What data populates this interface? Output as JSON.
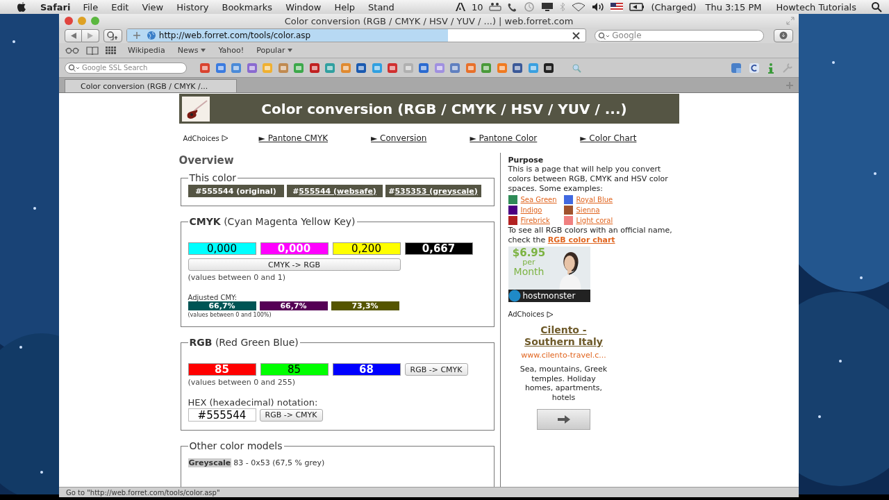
{
  "menu_bar": {
    "app": "Safari",
    "items": [
      "File",
      "Edit",
      "View",
      "History",
      "Bookmarks",
      "Window",
      "Help",
      "Stand"
    ],
    "adobe_count": "10",
    "battery": "(Charged)",
    "clock": "Thu 3:15 PM",
    "user": "Howtech Tutorials"
  },
  "window": {
    "title": "Color conversion (RGB / CMYK / HSV / YUV / ...) | web.forret.com"
  },
  "toolbar": {
    "address": "http://web.forret.com/tools/color.asp",
    "level": 0.7,
    "search_placeholder": "Google"
  },
  "bookmarks": [
    {
      "label": "Wikipedia",
      "menu": false
    },
    {
      "label": "News",
      "menu": true
    },
    {
      "label": "Yahoo!",
      "menu": false
    },
    {
      "label": "Popular",
      "menu": true
    }
  ],
  "extension_bar": {
    "search_placeholder": "Google SSL Search"
  },
  "tabs": [
    {
      "label": "Color conversion (RGB / CMYK /...",
      "selected": true
    }
  ],
  "page": {
    "title": "Color conversion (RGB / CMYK / HSV / YUV / ...)",
    "adchoices": "AdChoices",
    "nav": [
      "► Pantone CMYK",
      "► Conversion",
      "► Pantone Color",
      "► Color Chart"
    ],
    "overview": "Overview",
    "this_color": {
      "legend": "This color",
      "swatches": [
        {
          "prefix": "#",
          "text": "555544 (original)",
          "link": false
        },
        {
          "prefix": "#",
          "text": "555544 (websafe)",
          "link": true
        },
        {
          "prefix": "#",
          "text": "535353 (greyscale)",
          "link": true
        }
      ]
    },
    "cmyk": {
      "legend": "**CMYK** (Cyan Magenta Yellow Key)",
      "values": [
        {
          "value": "0,000",
          "color": "#00ffff"
        },
        {
          "value": "0,000",
          "color": "#ff00ff"
        },
        {
          "value": "0,200",
          "color": "#ffff00"
        },
        {
          "value": "0,667",
          "color": "#000000"
        }
      ],
      "button": "CMYK -> RGB",
      "hint": "(values between 0 and 1)",
      "adjusted_label": "Adjusted CMY:",
      "adjusted": [
        {
          "value": "66,7%",
          "color": "#005555"
        },
        {
          "value": "66,7%",
          "color": "#550055"
        },
        {
          "value": "73,3%",
          "color": "#555500"
        }
      ],
      "adjusted_hint": "(values between 0 and 100%)"
    },
    "rgb": {
      "legend": "**RGB** (Red Green Blue)",
      "values": [
        {
          "value": "85",
          "color": "#ff0000"
        },
        {
          "value": "85",
          "color": "#00ff00"
        },
        {
          "value": "68",
          "color": "#0000ff"
        }
      ],
      "button": "RGB -> CMYK",
      "hint": "(values between 0 and 255)",
      "hex_label": "HEX (hexadecimal) notation:",
      "hex_value": "#555544",
      "hex_button": "RGB -> CMYK"
    },
    "other": {
      "legend": "Other color models",
      "rows": [
        {
          "label": "Greyscale",
          "value": "83 - 0x53 (67,5 % grey)"
        }
      ]
    },
    "sidebar": {
      "heading": "Purpose",
      "intro": "This is a page that will help you convert colors between RGB, CMYK and HSV color spaces. Some examples:",
      "examples": [
        {
          "label": "Sea Green",
          "color": "#2e8b57"
        },
        {
          "label": "Royal Blue",
          "color": "#4169e1"
        },
        {
          "label": "Indigo",
          "color": "#4b0082"
        },
        {
          "label": "Sienna",
          "color": "#a0522d"
        },
        {
          "label": "Firebrick",
          "color": "#b22222"
        },
        {
          "label": "Light coral",
          "color": "#f08080"
        }
      ],
      "chart_text": "To see all RGB colors with an official name, check the",
      "chart_link": "RGB color chart",
      "banner": {
        "price": "$6.95",
        "per": "per",
        "month": "Month",
        "brand": "hostmonster"
      },
      "adchoices": "AdChoices",
      "ad": {
        "title": "Cilento - Southern Italy",
        "url": "www.cilento-travel.c...",
        "body": "Sea, mountains, Greek temples. Holiday homes, apartments, hotels"
      }
    }
  },
  "status_bar": "Go to \"http://web.forret.com/tools/color.asp\""
}
